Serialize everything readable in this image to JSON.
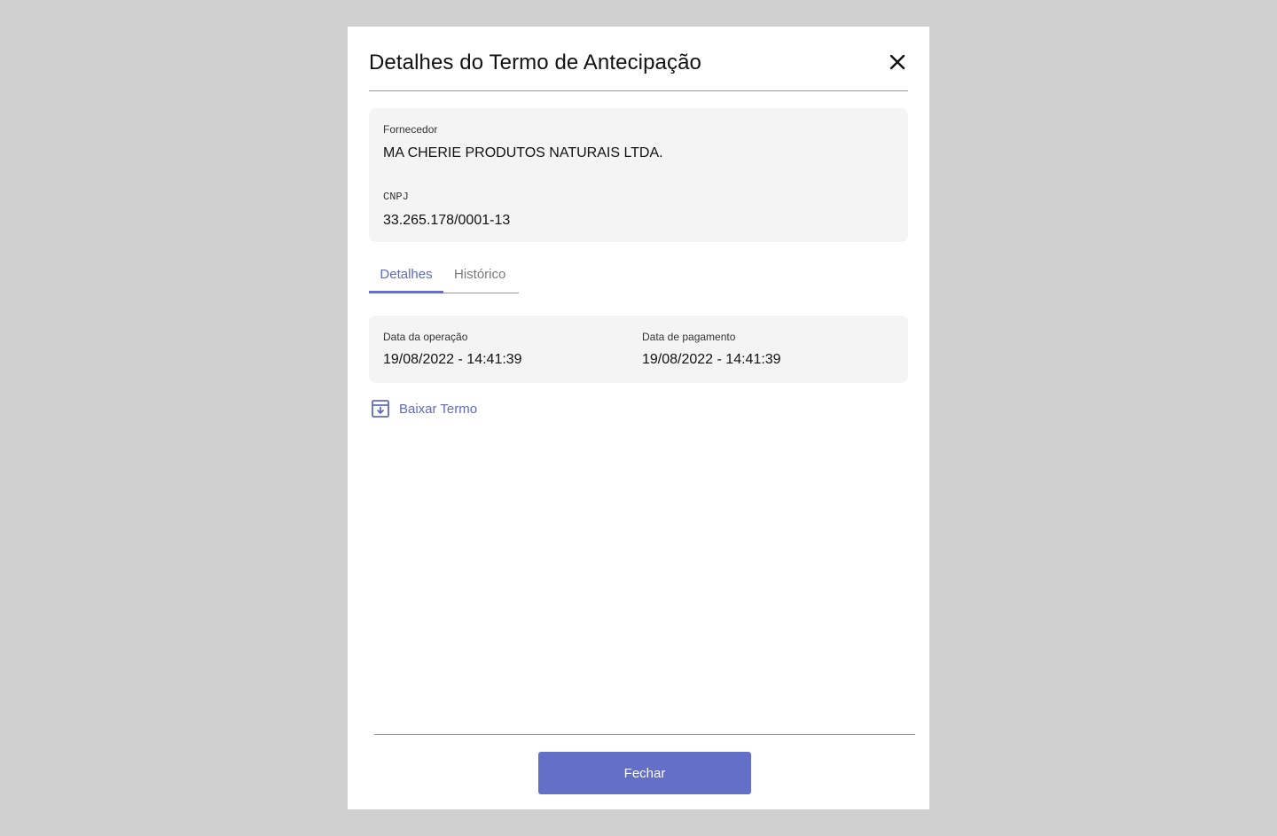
{
  "modal": {
    "title": "Detalhes do Termo de Antecipação",
    "close_icon": "close-icon"
  },
  "supplier": {
    "name_label": "Fornecedor",
    "name_value": "MA CHERIE PRODUTOS NATURAIS LTDA.",
    "cnpj_label": "CNPJ",
    "cnpj_value": "33.265.178/0001-13"
  },
  "tabs": [
    {
      "label": "Detalhes",
      "active": true
    },
    {
      "label": "Histórico",
      "active": false
    }
  ],
  "details": {
    "operation_date_label": "Data da operação",
    "operation_date_value": "19/08/2022 - 14:41:39",
    "payment_date_label": "Data de pagamento",
    "payment_date_value": "19/08/2022 - 14:41:39"
  },
  "download": {
    "label": "Baixar Termo",
    "icon": "download-box-icon"
  },
  "footer": {
    "close_button_label": "Fechar"
  },
  "colors": {
    "accent": "#6470c8",
    "overlay": "#d0d0d0",
    "card_bg": "#f4f4f4"
  }
}
